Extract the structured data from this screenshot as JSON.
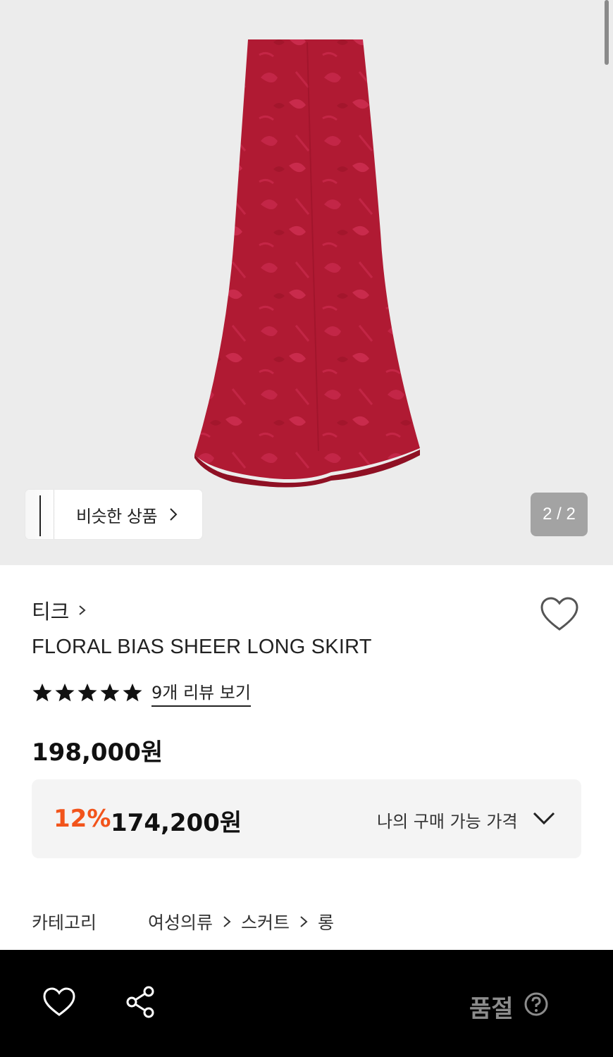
{
  "gallery": {
    "similar_label": "비슷한 상품",
    "counter": "2 / 2"
  },
  "product": {
    "brand": "티크",
    "name": "FLORAL BIAS SHEER LONG SKIRT",
    "rating_stars": 5,
    "review_link": "9개 리뷰 보기",
    "original_price": "198,000원",
    "discount_rate": "12%",
    "sale_price": "174,200원",
    "my_price_label": "나의 구매 가능 가격"
  },
  "category": {
    "label": "카테고리",
    "path": [
      "여성의류",
      "스커트",
      "롱"
    ]
  },
  "bottom_bar": {
    "sold_out": "품절"
  },
  "colors": {
    "discount": "#f2541b",
    "skirt": "#b31b35",
    "bottom_bar_bg": "#000000"
  }
}
